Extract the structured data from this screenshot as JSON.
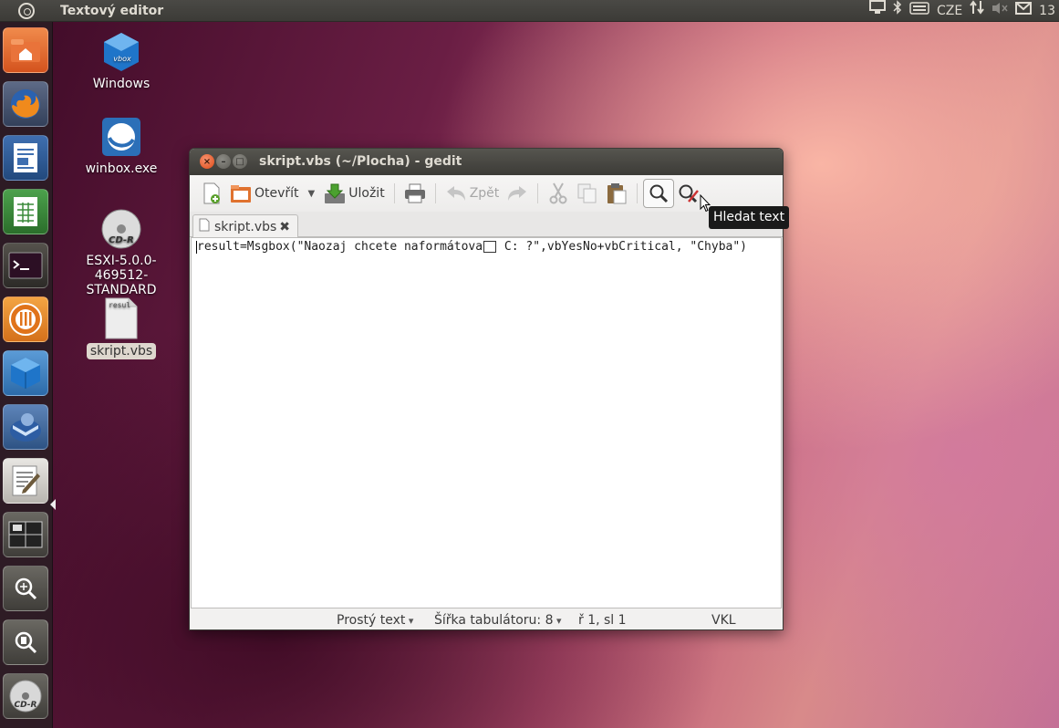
{
  "top_panel": {
    "app_title": "Textový editor",
    "keyboard_layout": "CZE",
    "clock": "13"
  },
  "launcher": {
    "items": [
      {
        "name": "home-folder"
      },
      {
        "name": "firefox"
      },
      {
        "name": "libreoffice-writer"
      },
      {
        "name": "libreoffice-calc"
      },
      {
        "name": "terminal"
      },
      {
        "name": "ubuntu-one"
      },
      {
        "name": "virtualbox"
      },
      {
        "name": "thunderbird"
      },
      {
        "name": "gedit",
        "active": true
      },
      {
        "name": "workspace-switcher"
      },
      {
        "name": "magnifier"
      },
      {
        "name": "search"
      },
      {
        "name": "cd-drive"
      }
    ]
  },
  "desktop": {
    "icons": [
      {
        "label": "Windows"
      },
      {
        "label": "winbox.exe"
      },
      {
        "label": "ESXI-5.0.0-469512-STANDARD",
        "line1": "ESXI-5.0.0-469512-",
        "line2": "STANDARD",
        "badge": "CD-R"
      },
      {
        "label": "skript.vbs",
        "preview": "resul",
        "selected": true
      }
    ]
  },
  "window": {
    "title": "skript.vbs (~/Plocha) - gedit",
    "toolbar": {
      "open_label": "Otevřít",
      "save_label": "Uložit",
      "undo_label": "Zpět"
    },
    "tab": {
      "label": "skript.vbs"
    },
    "editor": {
      "line_before": "result=Msgbox(\"Naozaj chcete naformátova",
      "line_after": " C: ?\",vbYesNo+vbCritical, \"Chyba\")"
    },
    "statusbar": {
      "language": "Prostý text",
      "tab_width": "Šířka tabulátoru:  8",
      "position": "ř 1, sl 1",
      "mode": "VKL"
    }
  },
  "tooltip": {
    "text": "Hledat text"
  },
  "colors": {
    "panel": "#3c3b37",
    "close_button": "#df4a16",
    "tooltip_bg": "#1a1a1a"
  }
}
